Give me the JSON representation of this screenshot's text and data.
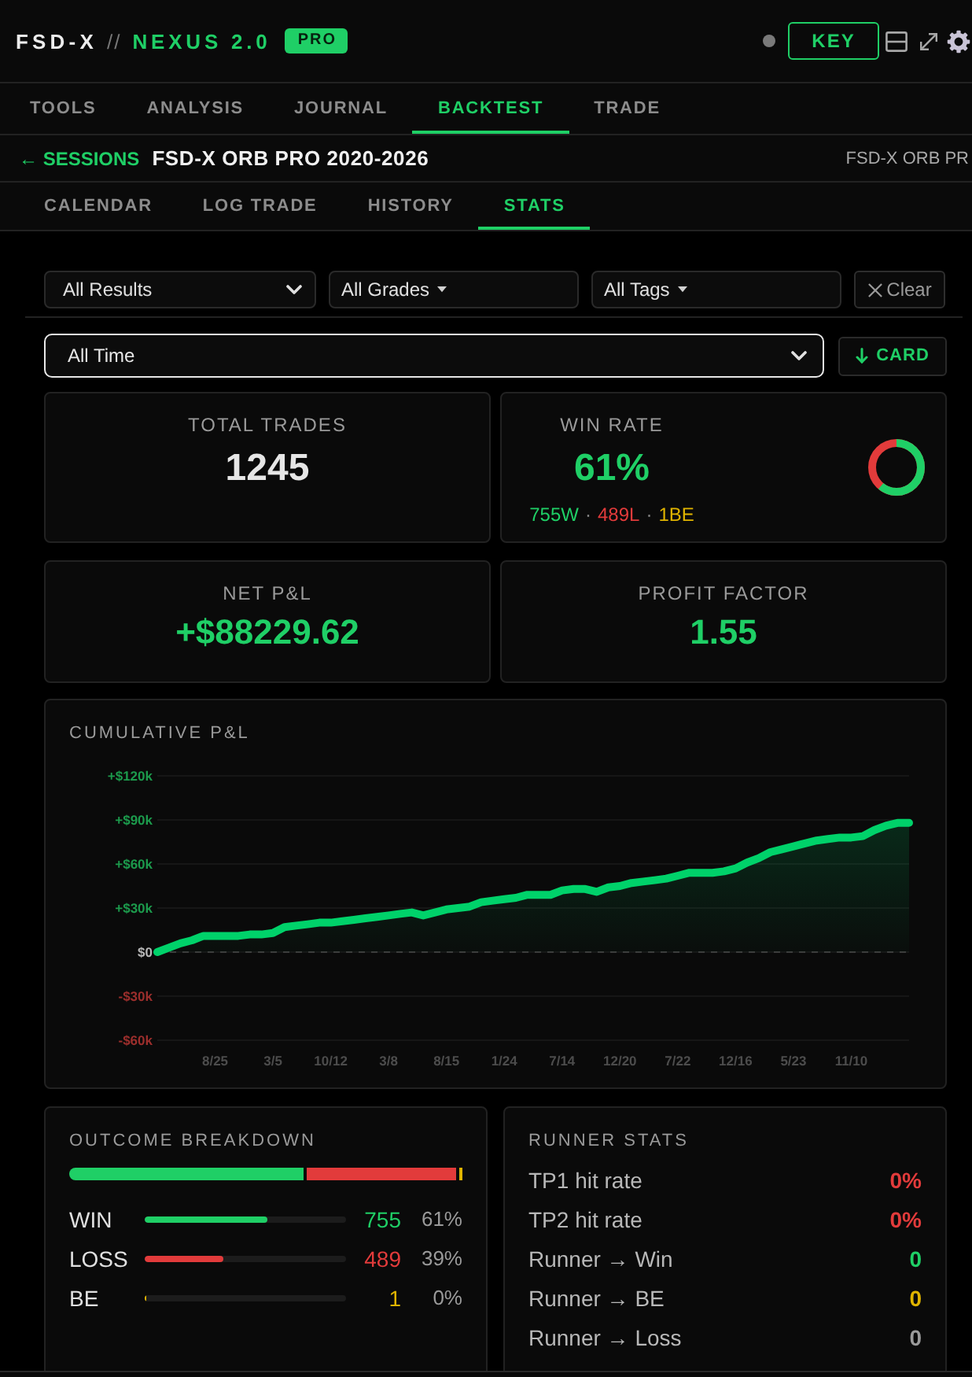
{
  "header": {
    "brand": "FSD-X",
    "separator": "//",
    "product": "NEXUS 2.0",
    "badge": "PRO",
    "key_button": "KEY"
  },
  "main_tabs": [
    {
      "label": "TOOLS",
      "selected": false
    },
    {
      "label": "ANALYSIS",
      "selected": false
    },
    {
      "label": "JOURNAL",
      "selected": false
    },
    {
      "label": "BACKTEST",
      "selected": true
    },
    {
      "label": "TRADE",
      "selected": false
    }
  ],
  "session_bar": {
    "back_link": "← SESSIONS",
    "title": "FSD-X ORB PRO 2020-2026",
    "right_label": "FSD-X ORB PR"
  },
  "sub_tabs": [
    {
      "label": "CALENDAR",
      "selected": false
    },
    {
      "label": "LOG TRADE",
      "selected": false
    },
    {
      "label": "HISTORY",
      "selected": false
    },
    {
      "label": "STATS",
      "selected": true
    }
  ],
  "filters": [
    {
      "kind": "select",
      "value": "All Results"
    },
    {
      "kind": "dropdown",
      "value": "All Grades"
    },
    {
      "kind": "dropdown",
      "value": "All Tags"
    },
    {
      "kind": "button",
      "label": "Clear"
    }
  ],
  "period": {
    "value": "All Time",
    "focused": true,
    "card_button": "CARD"
  },
  "stats": [
    {
      "kind": "plain",
      "label": "TOTAL TRADES",
      "value": "1245",
      "color": "#e6e6e6"
    },
    {
      "kind": "donut",
      "label": "WIN RATE",
      "value": "61%",
      "color": "#1fcf66",
      "level": 0.61,
      "breakdown": [
        {
          "text": "755W",
          "color": "#1fcf66"
        },
        {
          "text": "489L",
          "color": "#e23b3b"
        },
        {
          "text": "1BE",
          "color": "#e0b400"
        }
      ],
      "separators": [
        "·",
        "·"
      ]
    },
    {
      "kind": "plain",
      "label": "NET P&L",
      "value": "+$88229.62",
      "color": "#1fcf66"
    },
    {
      "kind": "plain",
      "label": "PROFIT FACTOR",
      "value": "1.55",
      "color": "#1fcf66"
    }
  ],
  "chart": {
    "chart_data": {
      "type": "area",
      "title": "CUMULATIVE P&L",
      "grid": true,
      "categories": [
        null,
        null,
        null,
        null,
        null,
        "8/25",
        null,
        null,
        null,
        null,
        "3/5",
        null,
        null,
        null,
        null,
        "10/12",
        null,
        null,
        null,
        null,
        "3/8",
        null,
        null,
        null,
        null,
        "8/15",
        null,
        null,
        null,
        null,
        "1/24",
        null,
        null,
        null,
        null,
        "7/14",
        null,
        null,
        null,
        null,
        "12/20",
        null,
        null,
        null,
        null,
        "7/22",
        null,
        null,
        null,
        null,
        "12/16",
        null,
        null,
        null,
        null,
        "5/23",
        null,
        null,
        null,
        null,
        "11/10",
        null,
        null,
        null,
        null,
        null
      ],
      "ylim": [
        -60000,
        120000
      ],
      "yticks": [
        {
          "value": 120000,
          "label": "+$120k"
        },
        {
          "value": 90000,
          "label": "+$90k"
        },
        {
          "value": 60000,
          "label": "+$60k"
        },
        {
          "value": 30000,
          "label": "+$30k"
        },
        {
          "value": 0,
          "label": "$0"
        },
        {
          "value": -30000,
          "label": "-$30k"
        },
        {
          "value": -60000,
          "label": "-$60k"
        }
      ],
      "ref_lines": [
        {
          "axis": "y",
          "value": 0
        }
      ],
      "series": [
        {
          "color": "#00d26a",
          "values": [
            0,
            3000,
            6000,
            8000,
            11000,
            11000,
            11000,
            11000,
            12000,
            12000,
            13000,
            17000,
            18000,
            19000,
            20000,
            20000,
            21000,
            22000,
            23000,
            24000,
            25000,
            26000,
            27000,
            25000,
            27000,
            29000,
            30000,
            31000,
            34000,
            35000,
            36000,
            37000,
            39000,
            39000,
            39000,
            42000,
            43000,
            43000,
            41000,
            44000,
            45000,
            47000,
            48000,
            49000,
            50000,
            52000,
            54000,
            54000,
            54000,
            55000,
            57000,
            61000,
            64000,
            68000,
            70000,
            72000,
            74000,
            76000,
            77000,
            78000,
            78000,
            79000,
            83000,
            86000,
            88000,
            88000
          ]
        }
      ]
    }
  },
  "outcome": {
    "title": "OUTCOME BREAKDOWN",
    "rows": [
      {
        "label": "WIN",
        "level": 0.61,
        "count": "755",
        "percent": "61%",
        "color": "#1fcf66"
      },
      {
        "label": "LOSS",
        "level": 0.39,
        "count": "489",
        "percent": "39%",
        "color": "#e23b3b"
      },
      {
        "label": "BE",
        "level": 0,
        "count": "1",
        "percent": "0%",
        "color": "#e0b400"
      }
    ]
  },
  "runner": {
    "title": "RUNNER STATS",
    "rows": [
      {
        "label": "TP1 hit rate",
        "value": "0%",
        "color": "#e23b3b"
      },
      {
        "label": "TP2 hit rate",
        "value": "0%",
        "color": "#e23b3b"
      },
      {
        "label": "Runner → Win",
        "value": "0",
        "color": "#1fcf66"
      },
      {
        "label": "Runner → BE",
        "value": "0",
        "color": "#e0b400"
      },
      {
        "label": "Runner → Loss",
        "value": "0",
        "color": "#9a9a9a"
      }
    ]
  }
}
